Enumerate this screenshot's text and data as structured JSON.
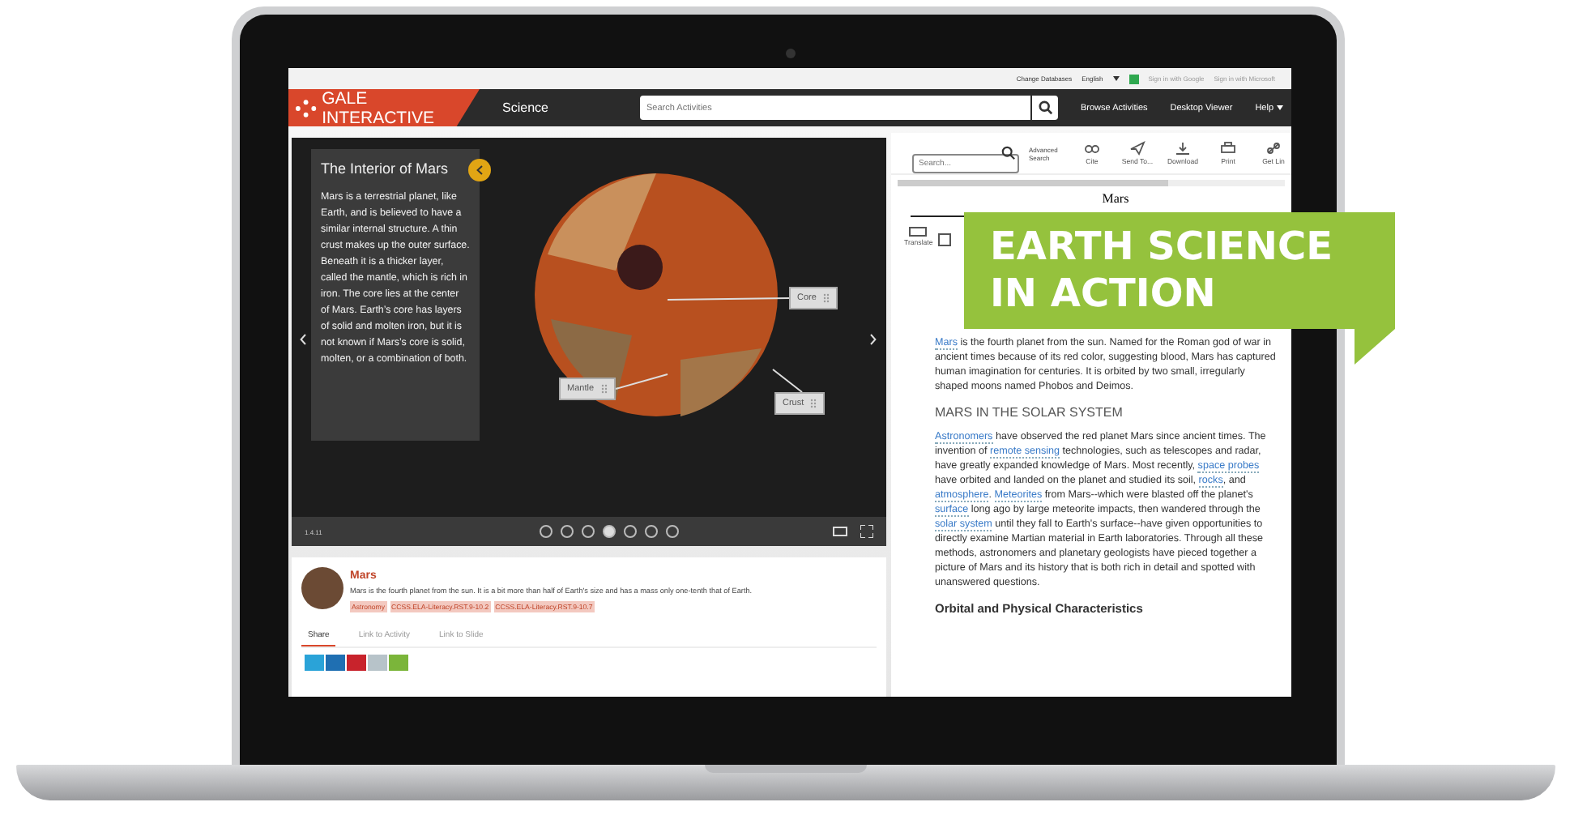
{
  "top_strip": {
    "change_databases": "Change Databases",
    "language": "English",
    "sign_in": [
      "Sign in with Google",
      "Sign in with Microsoft"
    ]
  },
  "header": {
    "logo": "GALE INTERACTIVE",
    "section": "Science",
    "search_placeholder": "Search Activities",
    "nav": [
      {
        "label": "Browse Activities",
        "dropdown": false
      },
      {
        "label": "Desktop Viewer",
        "dropdown": false
      },
      {
        "label": "Help",
        "dropdown": true
      }
    ]
  },
  "viewer": {
    "title": "The Interior of Mars",
    "body": "Mars is a terrestrial planet, like Earth, and is believed to have a similar internal structure. A thin crust makes up the outer surface. Beneath it is a thicker layer, called the mantle, which is rich in iron. The core lies at the center of Mars. Earth’s core has layers of solid and molten iron, but it is not known if Mars’s core is solid, molten, or a combination of both.",
    "labels": [
      {
        "text": "Core",
        "kind": "core"
      },
      {
        "text": "Mantle",
        "kind": "mantle"
      },
      {
        "text": "Crust",
        "kind": "crust"
      }
    ],
    "version": "1.4.11",
    "slides": [
      {
        "selected": false
      },
      {
        "selected": false
      },
      {
        "selected": false
      },
      {
        "selected": true
      },
      {
        "selected": false
      },
      {
        "selected": false
      },
      {
        "selected": false
      }
    ]
  },
  "activity": {
    "title": "Mars",
    "description": "Mars is the fourth planet from the sun. It is a bit more than half of Earth's size and has a mass only one-tenth that of Earth.",
    "tags": [
      "Astronomy",
      "CCSS.ELA-Literacy.RST.9-10.2",
      "CCSS.ELA-Literacy.RST.9-10.7"
    ],
    "tabs": [
      {
        "label": "Share",
        "selected": true
      },
      {
        "label": "Link to Activity",
        "selected": false
      },
      {
        "label": "Link to Slide",
        "selected": false
      }
    ],
    "share_buttons": [
      {
        "color": "#2aa3d8"
      },
      {
        "color": "#1f6fb2"
      },
      {
        "color": "#c8232c"
      },
      {
        "color": "#b7c3c9"
      },
      {
        "color": "#7bb53a"
      }
    ]
  },
  "reader": {
    "search_placeholder": "Search...",
    "advanced": "Advanced Search",
    "tools": [
      {
        "label": "Cite",
        "kind": "cite"
      },
      {
        "label": "Send To...",
        "kind": "send"
      },
      {
        "label": "Download",
        "kind": "download"
      },
      {
        "label": "Print",
        "kind": "print"
      },
      {
        "label": "Get Lin",
        "kind": "link"
      }
    ],
    "title": "Mars",
    "translate": "Translate",
    "paragraphs": [
      {
        "kind": "text",
        "parts": [
          {
            "text": "Mars",
            "link": true
          },
          {
            "text": " is the fourth planet from the sun. Named for the Roman god of war in ancient times because of its red color, suggesting blood, Mars has captured human imagination for centuries. It is orbited by two small, irregularly shaped moons named Phobos and Deimos.",
            "link": false
          }
        ]
      },
      {
        "kind": "heading",
        "text": "MARS IN THE SOLAR SYSTEM"
      },
      {
        "kind": "text",
        "parts": [
          {
            "text": "Astronomers",
            "link": true
          },
          {
            "text": " have observed the red planet Mars since ancient times. The invention of ",
            "link": false
          },
          {
            "text": "remote sensing",
            "link": true
          },
          {
            "text": " technologies, such as telescopes and radar, have greatly expanded knowledge of Mars. Most recently, ",
            "link": false
          },
          {
            "text": "space probes",
            "link": true
          },
          {
            "text": " have orbited and landed on the planet and studied its soil, ",
            "link": false
          },
          {
            "text": "rocks",
            "link": true
          },
          {
            "text": ", and ",
            "link": false
          },
          {
            "text": "atmosphere",
            "link": true
          },
          {
            "text": ". ",
            "link": false
          },
          {
            "text": "Meteorites",
            "link": true
          },
          {
            "text": " from Mars--which were blasted off the planet's ",
            "link": false
          },
          {
            "text": "surface",
            "link": true
          },
          {
            "text": " long ago by large meteorite impacts, then wandered through the ",
            "link": false
          },
          {
            "text": "solar system",
            "link": true
          },
          {
            "text": " until they fall to Earth's surface--have given opportunities to directly examine Martian material in Earth laboratories. Through all these methods, astronomers and planetary geologists have pieced together a picture of Mars and its history that is both rich in detail and spotted with unanswered questions.",
            "link": false
          }
        ]
      },
      {
        "kind": "subheading",
        "text": "Orbital and Physical Characteristics"
      }
    ]
  },
  "banner": {
    "lines": [
      "EARTH SCIENCE",
      "IN ACTION"
    ]
  }
}
